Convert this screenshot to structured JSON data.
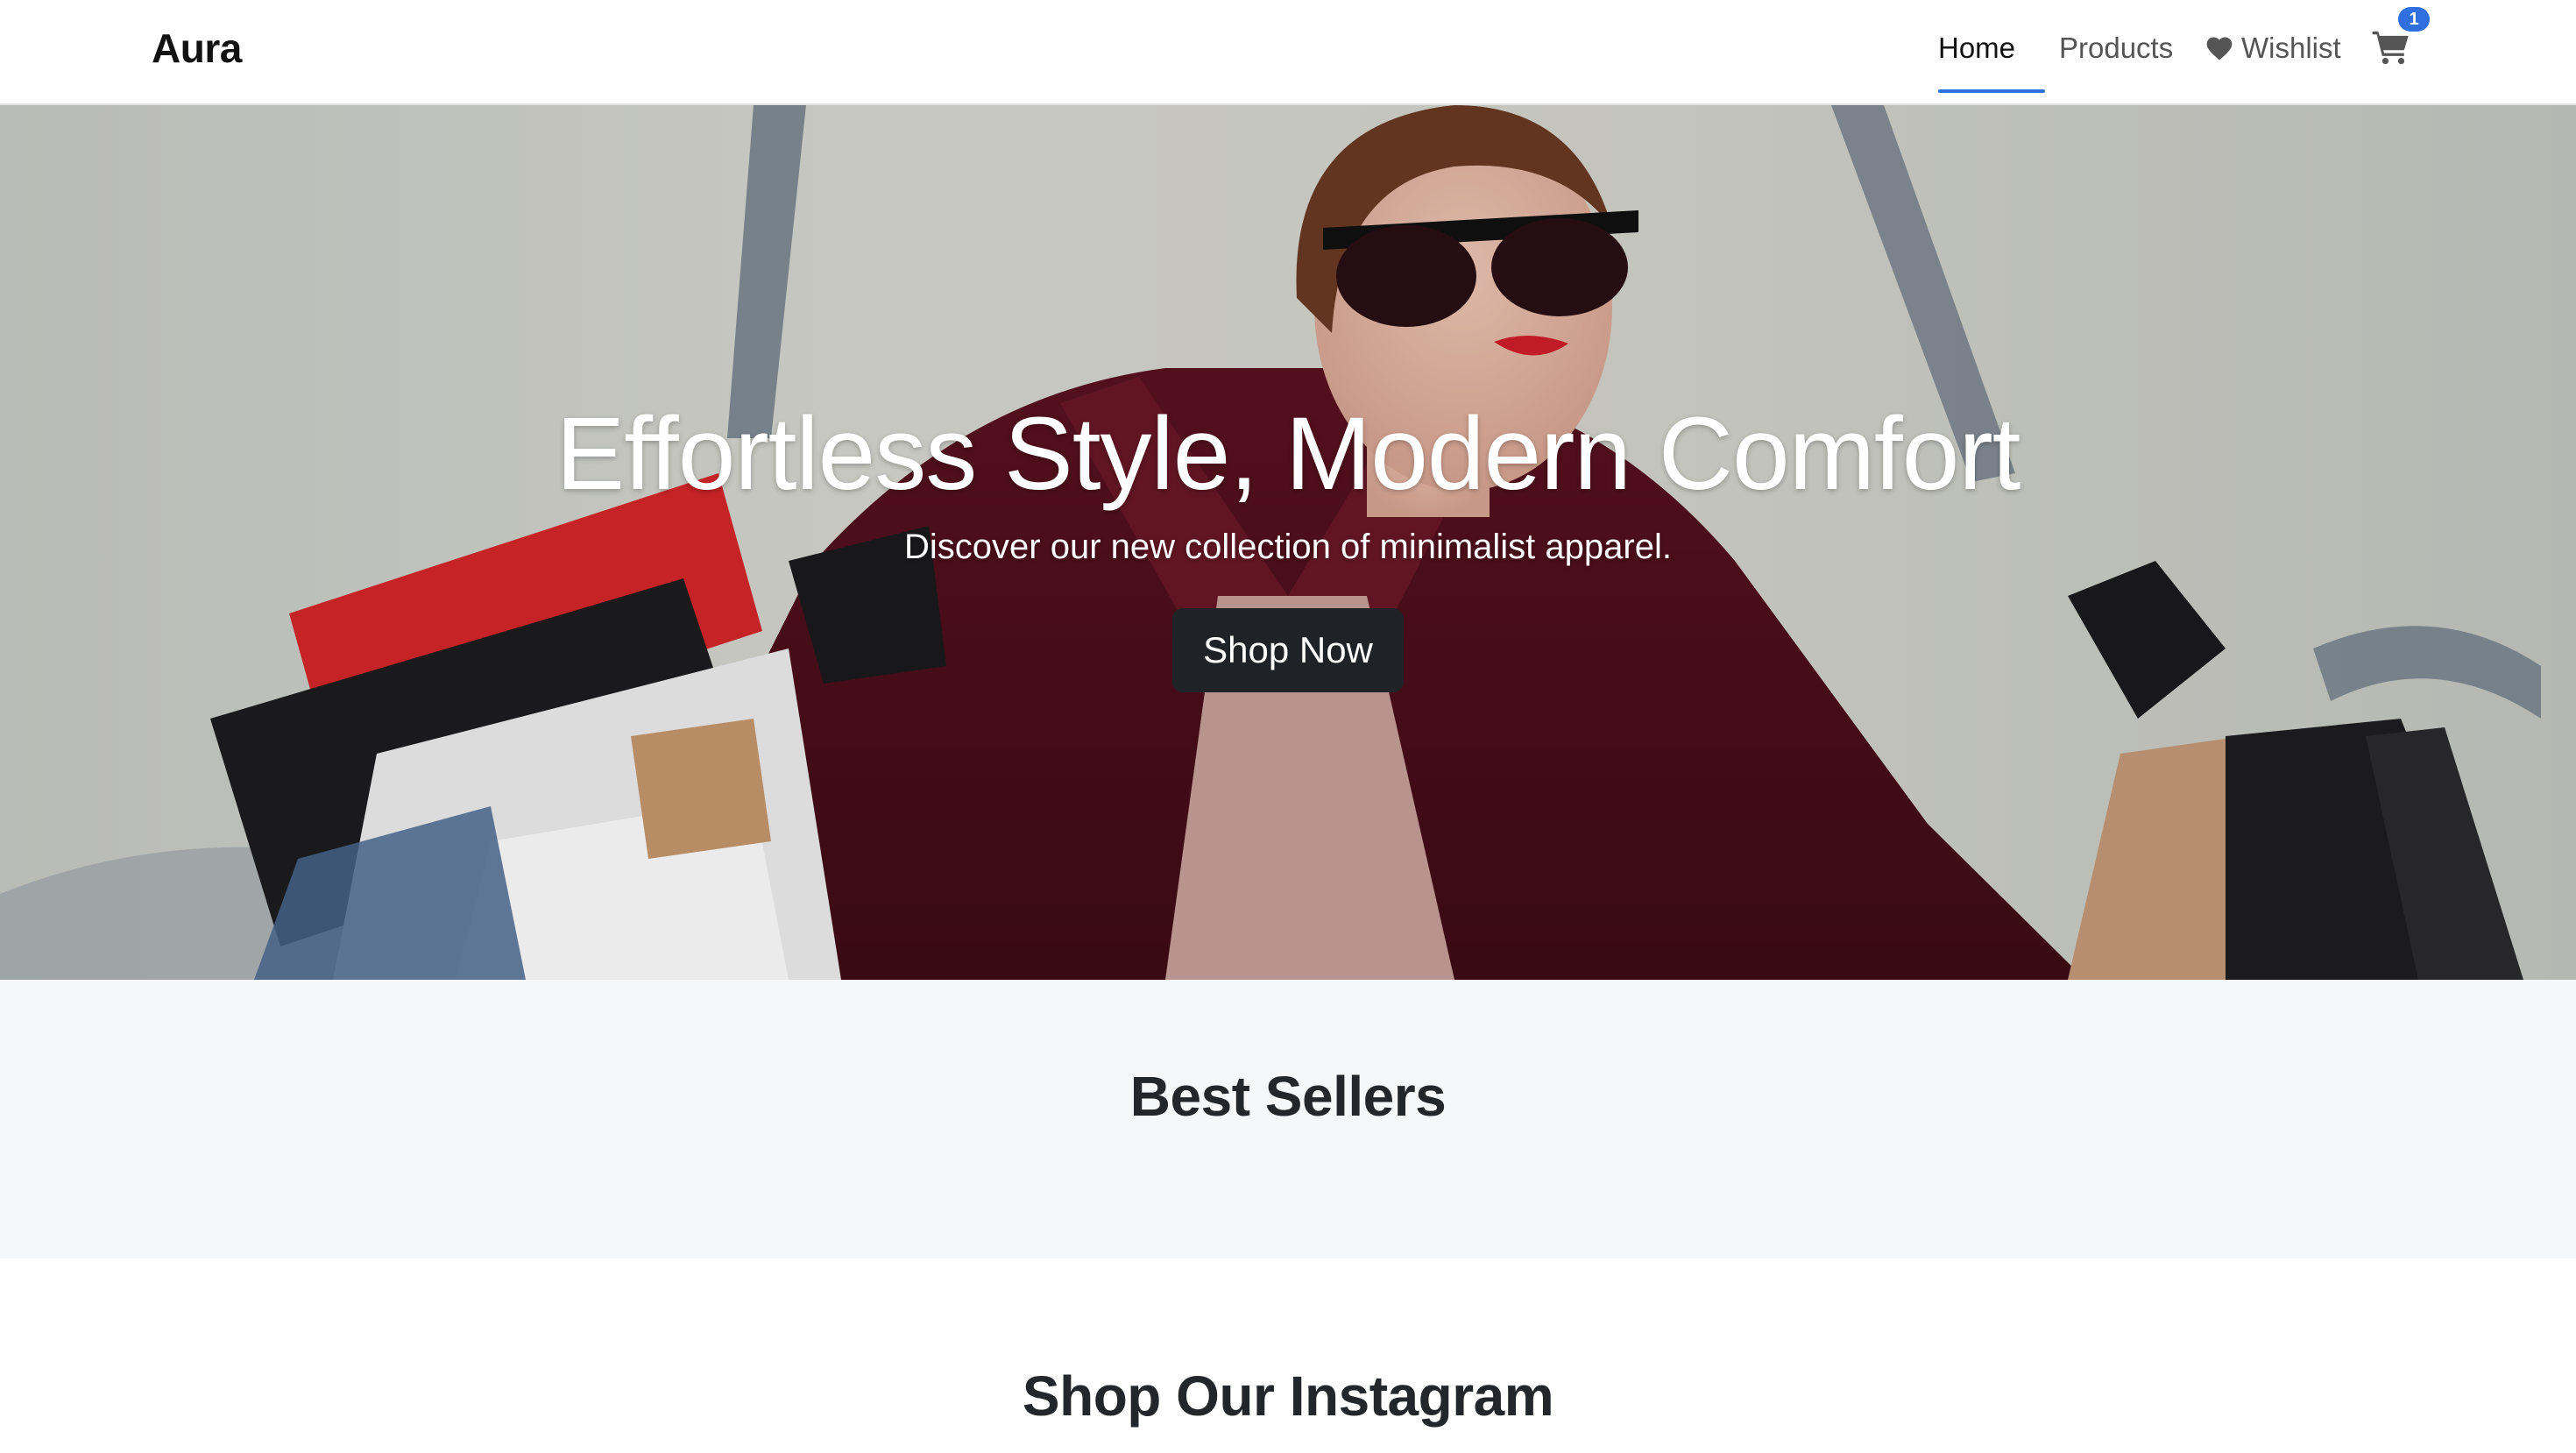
{
  "navbar": {
    "brand": "Aura",
    "links": {
      "home": "Home",
      "products": "Products",
      "wishlist": "Wishlist"
    },
    "cart_count": "1",
    "icons": {
      "wishlist": "heart-icon",
      "cart": "cart-icon"
    }
  },
  "hero": {
    "title": "Effortless Style, Modern Comfort",
    "subtitle": "Discover our new collection of minimalist apparel.",
    "cta_label": "Shop Now"
  },
  "sections": {
    "best_sellers_title": "Best Sellers",
    "instagram_title": "Shop Our Instagram"
  },
  "colors": {
    "accent": "#2f6fdf",
    "button_dark": "#1f2327",
    "section_bg": "#f6f7f9"
  }
}
